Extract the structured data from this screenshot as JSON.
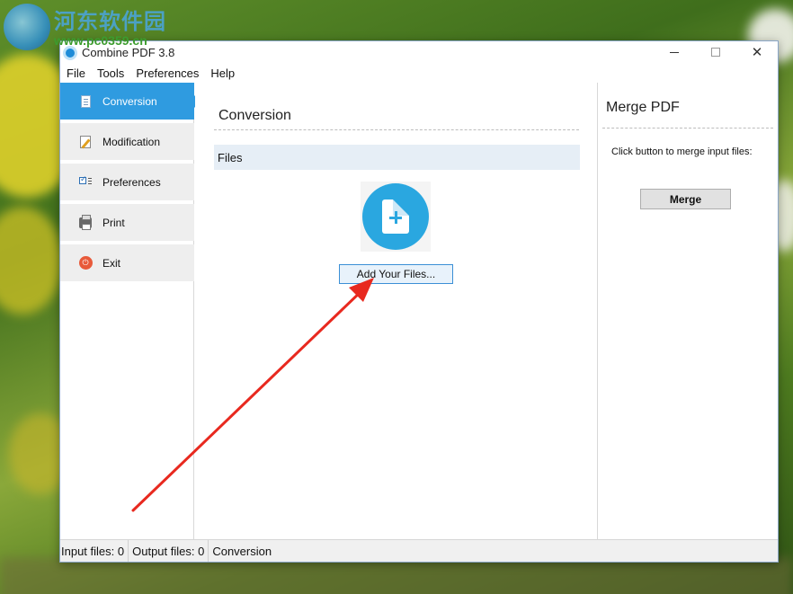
{
  "watermark": {
    "title": "河东软件园",
    "url": "www.pc0359.cn"
  },
  "window": {
    "title": "Combine PDF 3.8",
    "minimize": "minimize",
    "maximize": "maximize",
    "close": "close"
  },
  "menu": {
    "items": [
      "File",
      "Tools",
      "Preferences",
      "Help"
    ]
  },
  "sidebar": {
    "items": [
      {
        "label": "Conversion",
        "icon": "document-icon",
        "active": true
      },
      {
        "label": "Modification",
        "icon": "edit-icon",
        "active": false
      },
      {
        "label": "Preferences",
        "icon": "checklist-icon",
        "active": false
      },
      {
        "label": "Print",
        "icon": "printer-icon",
        "active": false
      },
      {
        "label": "Exit",
        "icon": "power-icon",
        "active": false
      }
    ]
  },
  "main": {
    "title": "Conversion",
    "files_header": "Files",
    "add_files_label": "Add Your Files..."
  },
  "merge": {
    "title": "Merge PDF",
    "description": "Click button to merge input files:",
    "button_label": "Merge"
  },
  "status": {
    "input_files": "Input files: 0",
    "output_files": "Output files: 0",
    "mode": "Conversion"
  },
  "colors": {
    "accent": "#2f9be0",
    "annotation_arrow": "#e8291f"
  }
}
